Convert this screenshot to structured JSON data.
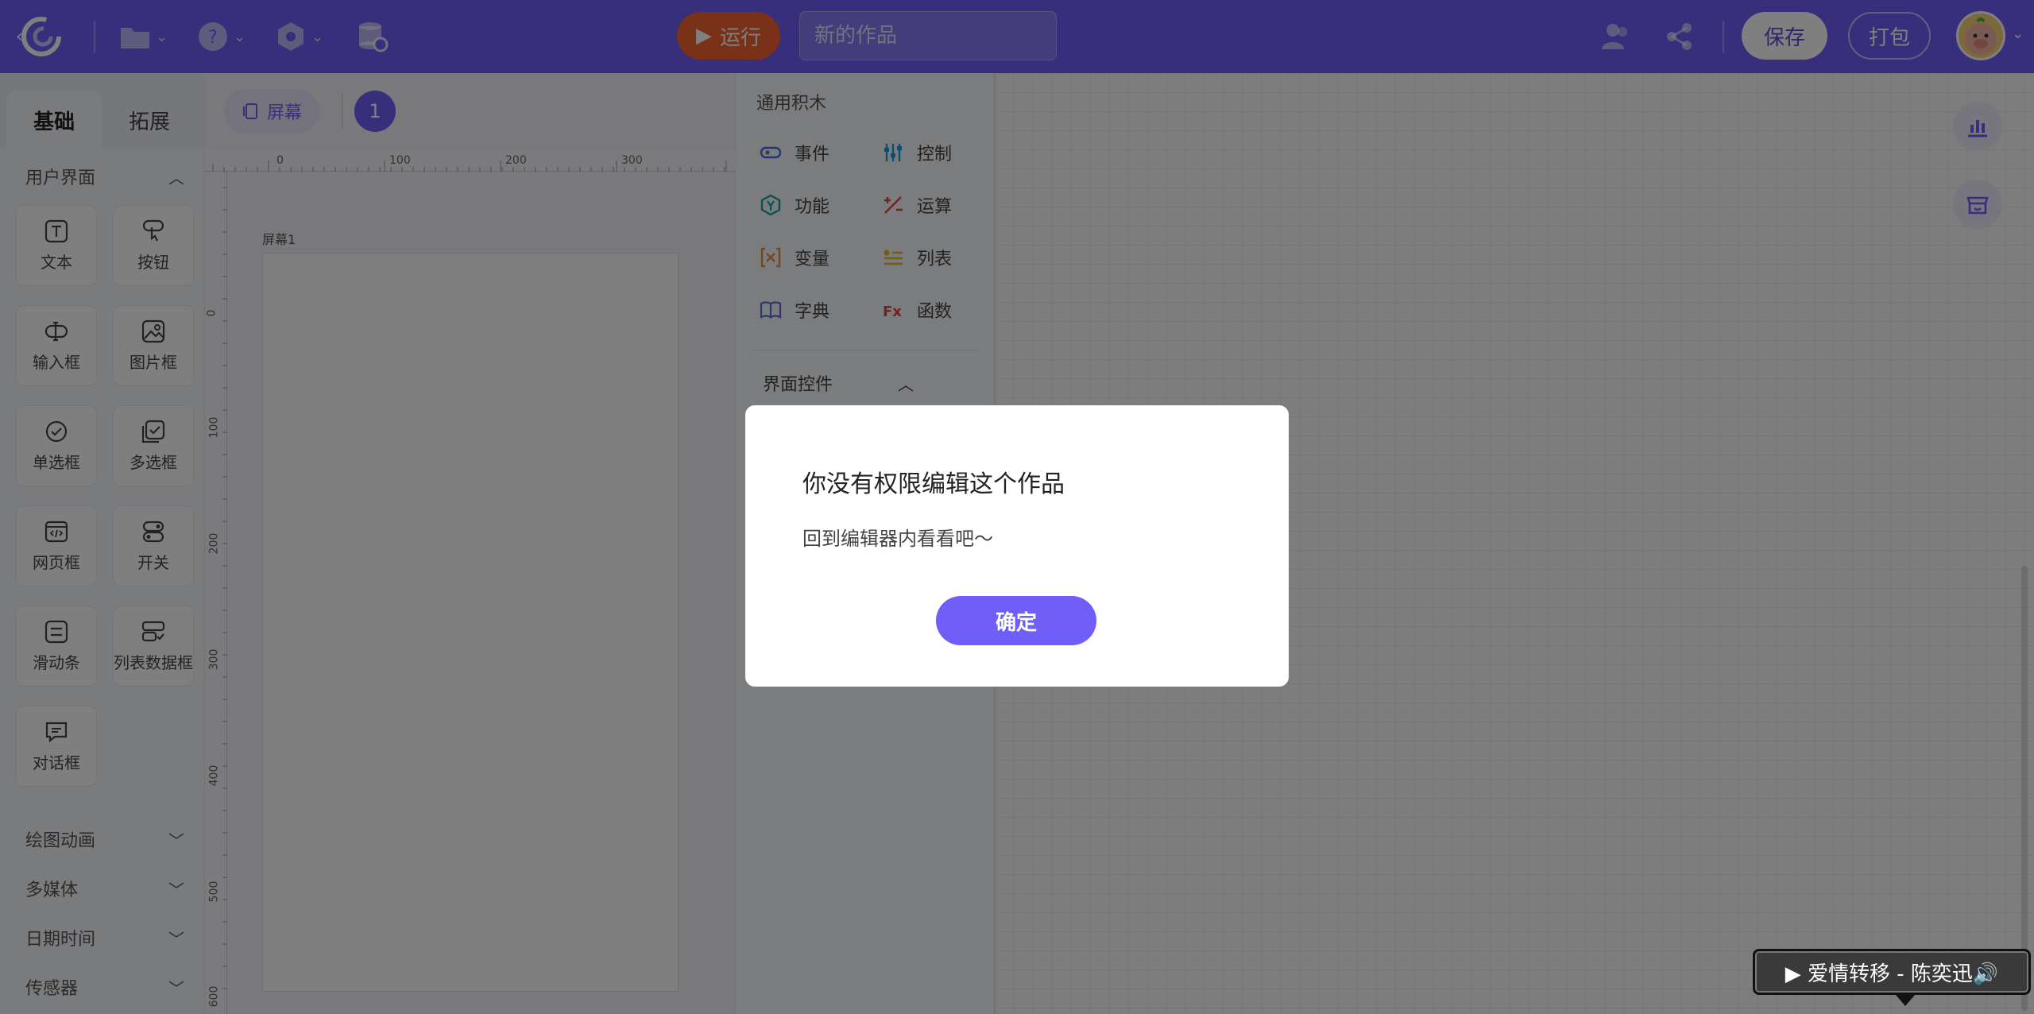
{
  "topbar": {
    "run_label": "运行",
    "title_placeholder": "新的作品",
    "save_label": "保存",
    "pack_label": "打包",
    "accent": "#6f5ef7",
    "run_color": "#f2652f"
  },
  "palette": {
    "tabs": [
      "基础",
      "拓展"
    ],
    "ui_section": "用户界面",
    "components": [
      "文本",
      "按钮",
      "输入框",
      "图片框",
      "单选框",
      "多选框",
      "网页框",
      "开关",
      "滑动条",
      "列表数据框",
      "对话框"
    ],
    "collapsed_sections": [
      "绘图动画",
      "多媒体",
      "日期时间",
      "传感器"
    ]
  },
  "canvas": {
    "screen_button": "屏幕",
    "page_number": "1",
    "screen_label": "屏幕1",
    "ruler_top": [
      "0",
      "100",
      "200",
      "300"
    ],
    "ruler_left": [
      "0",
      "100",
      "200",
      "300",
      "400",
      "500",
      "600"
    ]
  },
  "blocks": {
    "title": "通用积木",
    "categories": [
      "事件",
      "控制",
      "功能",
      "运算",
      "变量",
      "列表",
      "字典",
      "函数"
    ],
    "ui_controls": "界面控件"
  },
  "modal": {
    "title": "你没有权限编辑这个作品",
    "message": "回到编辑器内看看吧～",
    "confirm": "确定"
  },
  "music": {
    "text": "▶ 爱情转移 - 陈奕迅🔊"
  }
}
